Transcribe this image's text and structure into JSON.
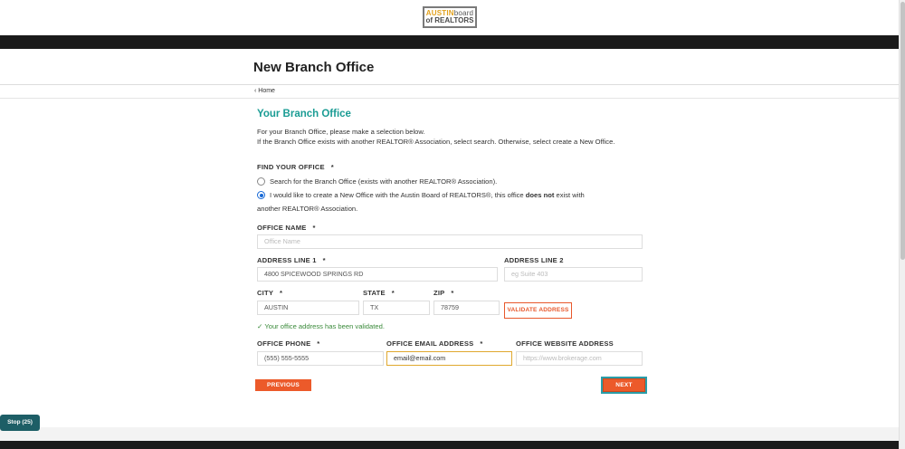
{
  "header": {
    "logo_line1_a": "AUSTIN",
    "logo_line1_b": "board",
    "logo_line2": "of REALTORS"
  },
  "page": {
    "title": "New Branch Office",
    "breadcrumb": "Home"
  },
  "section": {
    "title": "Your Branch Office",
    "intro_line1": "For your Branch Office, please make a selection below.",
    "intro_line2": "If the Branch Office exists with another REALTOR® Association, select search. Otherwise, select create a New Office."
  },
  "find_office": {
    "label": "FIND YOUR OFFICE",
    "required": "*",
    "option_search": "Search for the Branch Office (exists with another REALTOR® Association).",
    "option_create_a": "I would like to create a New Office with the Austin Board of REALTORS®, this office",
    "option_create_bold": "does not",
    "option_create_b": "exist with",
    "option_create_c": "another REALTOR® Association.",
    "selected": "create"
  },
  "fields": {
    "office_name": {
      "label": "OFFICE NAME",
      "placeholder": "Office Name",
      "value": ""
    },
    "address1": {
      "label": "ADDRESS LINE 1",
      "value": "4800 SPICEWOOD SPRINGS RD"
    },
    "address2": {
      "label": "ADDRESS LINE 2",
      "placeholder": "eg Suite 403",
      "value": ""
    },
    "city": {
      "label": "CITY",
      "value": "AUSTIN"
    },
    "state": {
      "label": "STATE",
      "value": "TX"
    },
    "zip": {
      "label": "ZIP",
      "value": "78759"
    },
    "phone": {
      "label": "OFFICE PHONE",
      "value": "(555) 555-5555"
    },
    "email": {
      "label": "OFFICE EMAIL ADDRESS",
      "value": "email@email.com"
    },
    "website": {
      "label": "OFFICE WEBSITE ADDRESS",
      "placeholder": "https://www.brokerage.com",
      "value": ""
    }
  },
  "required_mark": "*",
  "validation": {
    "check": "✓",
    "message": "Your office address has been validated."
  },
  "buttons": {
    "validate": "VALIDATE ADDRESS",
    "previous": "PREVIOUS",
    "next": "NEXT",
    "stop": "Stop (25)"
  },
  "colors": {
    "accent_teal": "#1a9c94",
    "button_orange": "#ec5a2a",
    "valid_green": "#3a8a3a"
  }
}
